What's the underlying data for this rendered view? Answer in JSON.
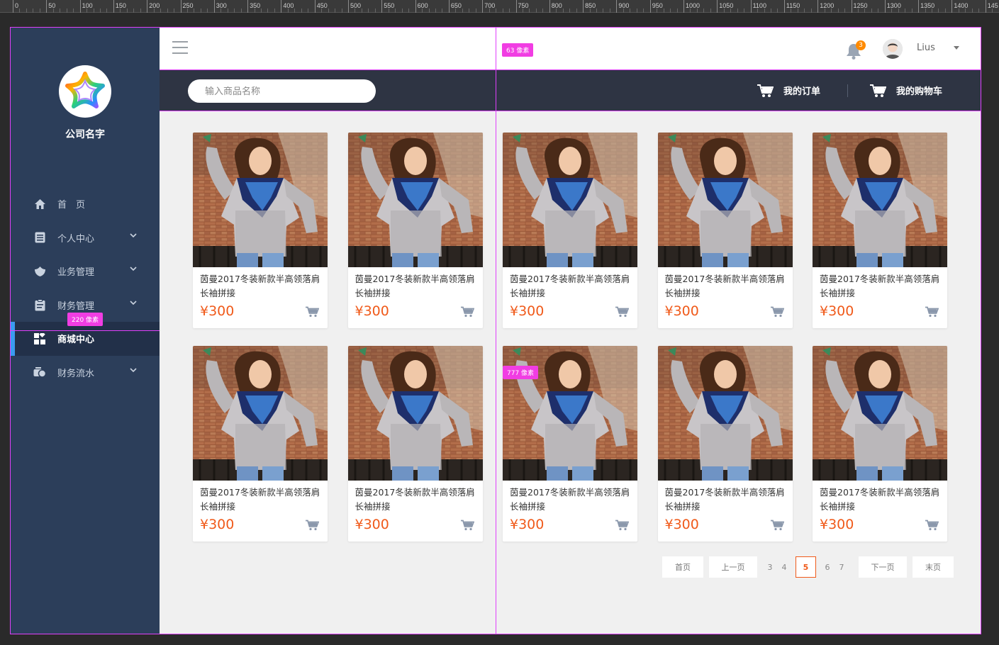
{
  "ruler": {
    "labels": [
      "0",
      "50",
      "100",
      "150",
      "200",
      "250",
      "300",
      "350",
      "400",
      "450",
      "500",
      "550",
      "600",
      "650",
      "700",
      "750",
      "800",
      "850",
      "900",
      "950",
      "1000",
      "1050",
      "1100",
      "1150",
      "1200",
      "1250",
      "1300",
      "1350",
      "1400",
      "145"
    ]
  },
  "sidebar": {
    "company_name": "公司名字",
    "items": [
      {
        "label": "首　页",
        "icon": "home-icon",
        "has_arrow": false
      },
      {
        "label": "个人中心",
        "icon": "profile-icon",
        "has_arrow": true
      },
      {
        "label": "业务管理",
        "icon": "business-icon",
        "has_arrow": true
      },
      {
        "label": "财务管理",
        "icon": "clipboard-icon",
        "has_arrow": true
      },
      {
        "label": "商城中心",
        "icon": "grid-icon",
        "has_arrow": false,
        "active": true
      },
      {
        "label": "财务流水",
        "icon": "finance-flow-icon",
        "has_arrow": true
      }
    ]
  },
  "topbar": {
    "notification_count": "3",
    "username": "Lius"
  },
  "subbar": {
    "search_placeholder": "输入商品名称",
    "my_orders": "我的订单",
    "my_cart": "我的购物车"
  },
  "products": [
    {
      "title": "茵曼2017冬装新款半高领落肩长袖拼接",
      "price": "¥300"
    },
    {
      "title": "茵曼2017冬装新款半高领落肩长袖拼接",
      "price": "¥300"
    },
    {
      "title": "茵曼2017冬装新款半高领落肩长袖拼接",
      "price": "¥300"
    },
    {
      "title": "茵曼2017冬装新款半高领落肩长袖拼接",
      "price": "¥300"
    },
    {
      "title": "茵曼2017冬装新款半高领落肩长袖拼接",
      "price": "¥300"
    },
    {
      "title": "茵曼2017冬装新款半高领落肩长袖拼接",
      "price": "¥300"
    },
    {
      "title": "茵曼2017冬装新款半高领落肩长袖拼接",
      "price": "¥300"
    },
    {
      "title": "茵曼2017冬装新款半高领落肩长袖拼接",
      "price": "¥300"
    },
    {
      "title": "茵曼2017冬装新款半高领落肩长袖拼接",
      "price": "¥300"
    },
    {
      "title": "茵曼2017冬装新款半高领落肩长袖拼接",
      "price": "¥300"
    }
  ],
  "pagination": {
    "first": "首页",
    "prev": "上一页",
    "pages": [
      "3",
      "4",
      "5",
      "6",
      "7"
    ],
    "current": "5",
    "next": "下一页",
    "last": "末页"
  },
  "measure_tags": {
    "topbar_height": "63 像素",
    "sidebar_width": "220 像素",
    "content_width": "777 像素"
  },
  "colors": {
    "sidebar_bg": "#2c3e5a",
    "accent": "#3a9cf0",
    "price": "#f05a1a",
    "subbar_bg": "#2e3443",
    "badge": "#ff8a00",
    "guide": "#e040fb"
  }
}
